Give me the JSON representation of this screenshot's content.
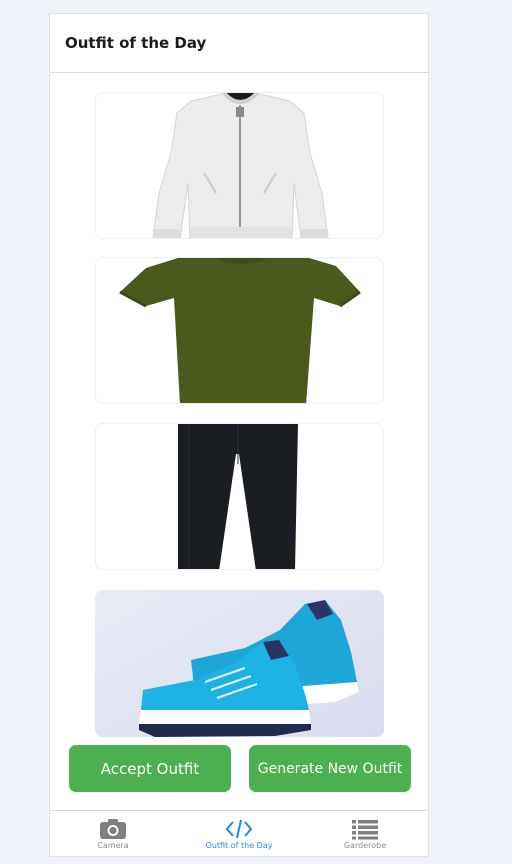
{
  "header": {
    "title": "Outfit of the Day"
  },
  "outfit": {
    "items": [
      {
        "name": "White bomber jacket",
        "color": "#f1f1f1"
      },
      {
        "name": "Olive green t-shirt",
        "color": "#4a5a1d"
      },
      {
        "name": "Black trousers",
        "color": "#1a1d22"
      },
      {
        "name": "Blue running sneakers",
        "color": "#1ea6d8"
      }
    ]
  },
  "actions": {
    "accept_label": "Accept Outfit",
    "generate_label": "Generate New Outfit",
    "button_color": "#4caf50"
  },
  "tabbar": {
    "tabs": [
      {
        "label": "Camera",
        "icon": "camera-icon",
        "active": false
      },
      {
        "label": "Outfit of the Day",
        "icon": "code-icon",
        "active": true
      },
      {
        "label": "Garderobe",
        "icon": "list-icon",
        "active": false
      }
    ],
    "active_color": "#1e88e5"
  }
}
